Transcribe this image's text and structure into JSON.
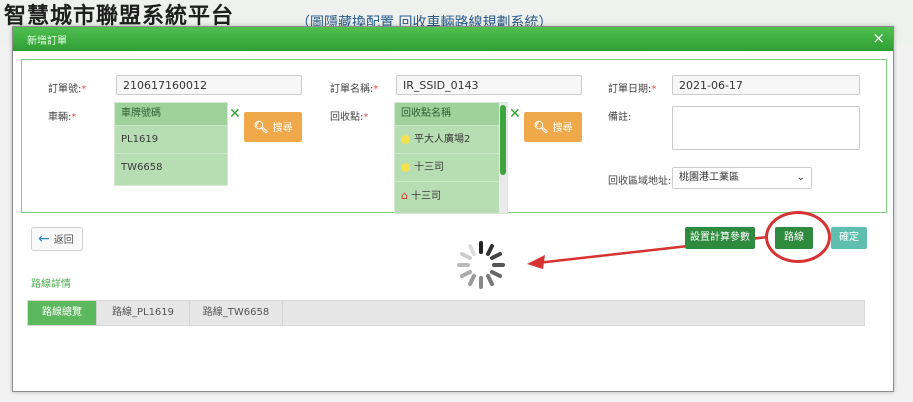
{
  "background_page": {
    "title": "智慧城市聯盟系統平台",
    "subtitle": "（圖隱藏換配置 回收車輛路線規劃系統）"
  },
  "modal": {
    "title": "新增訂單",
    "close_glyph": "×"
  },
  "form": {
    "order_no": {
      "label": "訂單號:",
      "required": "*",
      "value": "210617160012"
    },
    "order_name": {
      "label": "訂單名稱:",
      "required": "*",
      "value": "IR_SSID_0143"
    },
    "order_date": {
      "label": "訂單日期:",
      "required": "*",
      "value": "2021-06-17"
    },
    "vehicle": {
      "label": "車輛:",
      "required": "*",
      "header": "車牌號碼",
      "items": [
        "PL1619",
        "TW6658"
      ],
      "search_label": "搜尋"
    },
    "recycle_point": {
      "label": "回收點:",
      "required": "*",
      "header": "回收點名稱",
      "items": [
        {
          "name": "平大人廣場2",
          "icon": "yellow-dot"
        },
        {
          "name": "十三司",
          "icon": "yellow-dot"
        },
        {
          "name": "十三司",
          "icon": "house"
        }
      ],
      "search_label": "搜尋"
    },
    "remark": {
      "label": "備註:"
    },
    "recycle_area": {
      "label": "回收區域地址:",
      "value": "桃園港工業區"
    }
  },
  "actions": {
    "back_label": "返回",
    "settings_label": "設置計算參數",
    "route_label": "路線",
    "confirm_label": "確定"
  },
  "route_info": {
    "title": "路線詳情",
    "tabs": [
      "路線總覽",
      "路線_PL1619",
      "路線_TW6658"
    ]
  },
  "colors": {
    "header_green": "#3aa93f",
    "accent_orange": "#f0a94a",
    "annotation_red": "#d83333"
  }
}
